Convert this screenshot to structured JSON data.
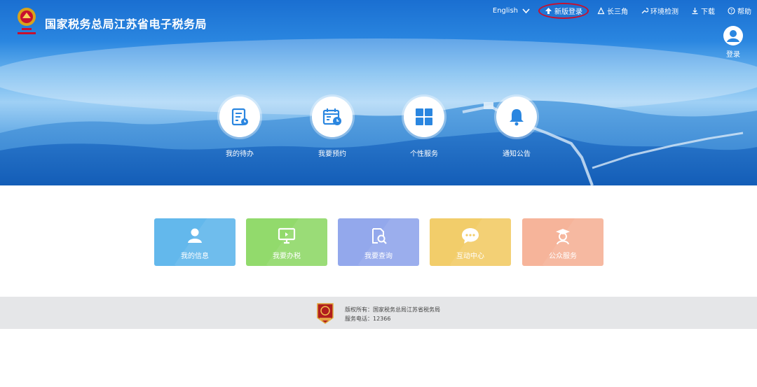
{
  "header": {
    "site_title": "国家税务总局江苏省电子税务局",
    "logo_icon": "tax-emblem-icon"
  },
  "topnav": {
    "language": "English",
    "new_login": "新版登录",
    "yangtze_delta": "长三角",
    "env_check": "环境检测",
    "download": "下载",
    "help": "帮助"
  },
  "user": {
    "login_label": "登录",
    "icon": "user-icon"
  },
  "quick_entries": [
    {
      "label": "我的待办",
      "icon": "todo-list-icon"
    },
    {
      "label": "我要预约",
      "icon": "calendar-clock-icon"
    },
    {
      "label": "个性服务",
      "icon": "grid-icon"
    },
    {
      "label": "通知公告",
      "icon": "bell-icon"
    }
  ],
  "tiles": [
    {
      "label": "我的信息",
      "icon": "person-icon",
      "color": "#63b8ec"
    },
    {
      "label": "我要办税",
      "icon": "monitor-icon",
      "color": "#92da6c"
    },
    {
      "label": "我要查询",
      "icon": "search-doc-icon",
      "color": "#93a8ec"
    },
    {
      "label": "互动中心",
      "icon": "chat-icon",
      "color": "#f2cd6a"
    },
    {
      "label": "公众服务",
      "icon": "cap-person-icon",
      "color": "#f6b49a"
    }
  ],
  "footer": {
    "copyright": "版权所有：国家税务总局江苏省税务局",
    "hotline": "服务电话：12366",
    "badge_icon": "party-gov-badge-icon"
  },
  "colors": {
    "brand_blue": "#1a6fd1",
    "highlight_red": "#c8102e"
  }
}
